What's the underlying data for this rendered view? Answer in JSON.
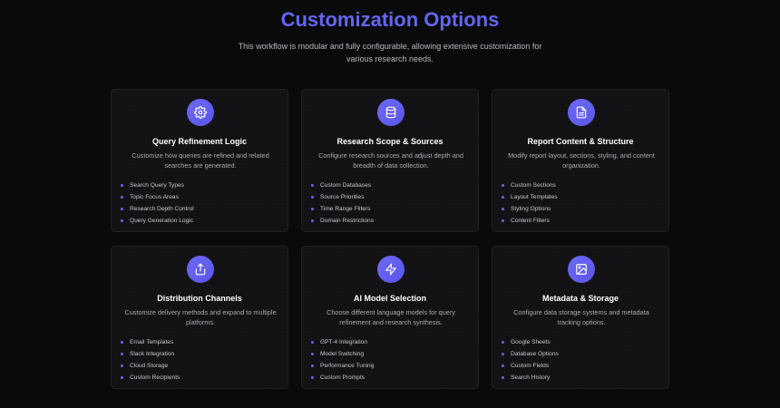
{
  "header": {
    "title": "Customization Options",
    "subtitle": "This workflow is modular and fully configurable, allowing extensive customization for various research needs."
  },
  "colors": {
    "accent": "#6366f1",
    "background": "#0a0a0a",
    "card": "#121214"
  },
  "cards": [
    {
      "icon": "gear-icon",
      "title": "Query Refinement Logic",
      "description": "Customize how queries are refined and related searches are generated.",
      "items": [
        "Search Query Types",
        "Topic Focus Areas",
        "Research Depth Control",
        "Query Generation Logic"
      ]
    },
    {
      "icon": "database-icon",
      "title": "Research Scope & Sources",
      "description": "Configure research sources and adjust depth and breadth of data collection.",
      "items": [
        "Custom Databases",
        "Source Priorities",
        "Time Range Filters",
        "Domain Restrictions"
      ]
    },
    {
      "icon": "document-icon",
      "title": "Report Content & Structure",
      "description": "Modify report layout, sections, styling, and content organization.",
      "items": [
        "Custom Sections",
        "Layout Templates",
        "Styling Options",
        "Content Filters"
      ]
    },
    {
      "icon": "share-icon",
      "title": "Distribution Channels",
      "description": "Customize delivery methods and expand to multiple platforms.",
      "items": [
        "Email Templates",
        "Slack Integration",
        "Cloud Storage",
        "Custom Recipients"
      ]
    },
    {
      "icon": "lightning-icon",
      "title": "AI Model Selection",
      "description": "Choose different language models for query refinement and research synthesis.",
      "items": [
        "GPT-4 Integration",
        "Model Switching",
        "Performance Tuning",
        "Custom Prompts"
      ]
    },
    {
      "icon": "image-icon",
      "title": "Metadata & Storage",
      "description": "Configure data storage systems and metadata tracking options.",
      "items": [
        "Google Sheets",
        "Database Options",
        "Custom Fields",
        "Search History"
      ]
    }
  ]
}
